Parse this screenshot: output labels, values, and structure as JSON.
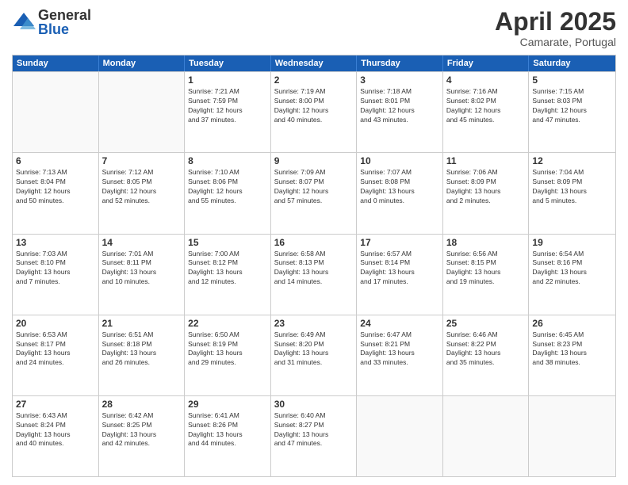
{
  "logo": {
    "general": "General",
    "blue": "Blue"
  },
  "title": "April 2025",
  "subtitle": "Camarate, Portugal",
  "header_days": [
    "Sunday",
    "Monday",
    "Tuesday",
    "Wednesday",
    "Thursday",
    "Friday",
    "Saturday"
  ],
  "weeks": [
    [
      {
        "day": "",
        "info": ""
      },
      {
        "day": "",
        "info": ""
      },
      {
        "day": "1",
        "info": "Sunrise: 7:21 AM\nSunset: 7:59 PM\nDaylight: 12 hours\nand 37 minutes."
      },
      {
        "day": "2",
        "info": "Sunrise: 7:19 AM\nSunset: 8:00 PM\nDaylight: 12 hours\nand 40 minutes."
      },
      {
        "day": "3",
        "info": "Sunrise: 7:18 AM\nSunset: 8:01 PM\nDaylight: 12 hours\nand 43 minutes."
      },
      {
        "day": "4",
        "info": "Sunrise: 7:16 AM\nSunset: 8:02 PM\nDaylight: 12 hours\nand 45 minutes."
      },
      {
        "day": "5",
        "info": "Sunrise: 7:15 AM\nSunset: 8:03 PM\nDaylight: 12 hours\nand 47 minutes."
      }
    ],
    [
      {
        "day": "6",
        "info": "Sunrise: 7:13 AM\nSunset: 8:04 PM\nDaylight: 12 hours\nand 50 minutes."
      },
      {
        "day": "7",
        "info": "Sunrise: 7:12 AM\nSunset: 8:05 PM\nDaylight: 12 hours\nand 52 minutes."
      },
      {
        "day": "8",
        "info": "Sunrise: 7:10 AM\nSunset: 8:06 PM\nDaylight: 12 hours\nand 55 minutes."
      },
      {
        "day": "9",
        "info": "Sunrise: 7:09 AM\nSunset: 8:07 PM\nDaylight: 12 hours\nand 57 minutes."
      },
      {
        "day": "10",
        "info": "Sunrise: 7:07 AM\nSunset: 8:08 PM\nDaylight: 13 hours\nand 0 minutes."
      },
      {
        "day": "11",
        "info": "Sunrise: 7:06 AM\nSunset: 8:09 PM\nDaylight: 13 hours\nand 2 minutes."
      },
      {
        "day": "12",
        "info": "Sunrise: 7:04 AM\nSunset: 8:09 PM\nDaylight: 13 hours\nand 5 minutes."
      }
    ],
    [
      {
        "day": "13",
        "info": "Sunrise: 7:03 AM\nSunset: 8:10 PM\nDaylight: 13 hours\nand 7 minutes."
      },
      {
        "day": "14",
        "info": "Sunrise: 7:01 AM\nSunset: 8:11 PM\nDaylight: 13 hours\nand 10 minutes."
      },
      {
        "day": "15",
        "info": "Sunrise: 7:00 AM\nSunset: 8:12 PM\nDaylight: 13 hours\nand 12 minutes."
      },
      {
        "day": "16",
        "info": "Sunrise: 6:58 AM\nSunset: 8:13 PM\nDaylight: 13 hours\nand 14 minutes."
      },
      {
        "day": "17",
        "info": "Sunrise: 6:57 AM\nSunset: 8:14 PM\nDaylight: 13 hours\nand 17 minutes."
      },
      {
        "day": "18",
        "info": "Sunrise: 6:56 AM\nSunset: 8:15 PM\nDaylight: 13 hours\nand 19 minutes."
      },
      {
        "day": "19",
        "info": "Sunrise: 6:54 AM\nSunset: 8:16 PM\nDaylight: 13 hours\nand 22 minutes."
      }
    ],
    [
      {
        "day": "20",
        "info": "Sunrise: 6:53 AM\nSunset: 8:17 PM\nDaylight: 13 hours\nand 24 minutes."
      },
      {
        "day": "21",
        "info": "Sunrise: 6:51 AM\nSunset: 8:18 PM\nDaylight: 13 hours\nand 26 minutes."
      },
      {
        "day": "22",
        "info": "Sunrise: 6:50 AM\nSunset: 8:19 PM\nDaylight: 13 hours\nand 29 minutes."
      },
      {
        "day": "23",
        "info": "Sunrise: 6:49 AM\nSunset: 8:20 PM\nDaylight: 13 hours\nand 31 minutes."
      },
      {
        "day": "24",
        "info": "Sunrise: 6:47 AM\nSunset: 8:21 PM\nDaylight: 13 hours\nand 33 minutes."
      },
      {
        "day": "25",
        "info": "Sunrise: 6:46 AM\nSunset: 8:22 PM\nDaylight: 13 hours\nand 35 minutes."
      },
      {
        "day": "26",
        "info": "Sunrise: 6:45 AM\nSunset: 8:23 PM\nDaylight: 13 hours\nand 38 minutes."
      }
    ],
    [
      {
        "day": "27",
        "info": "Sunrise: 6:43 AM\nSunset: 8:24 PM\nDaylight: 13 hours\nand 40 minutes."
      },
      {
        "day": "28",
        "info": "Sunrise: 6:42 AM\nSunset: 8:25 PM\nDaylight: 13 hours\nand 42 minutes."
      },
      {
        "day": "29",
        "info": "Sunrise: 6:41 AM\nSunset: 8:26 PM\nDaylight: 13 hours\nand 44 minutes."
      },
      {
        "day": "30",
        "info": "Sunrise: 6:40 AM\nSunset: 8:27 PM\nDaylight: 13 hours\nand 47 minutes."
      },
      {
        "day": "",
        "info": ""
      },
      {
        "day": "",
        "info": ""
      },
      {
        "day": "",
        "info": ""
      }
    ]
  ]
}
